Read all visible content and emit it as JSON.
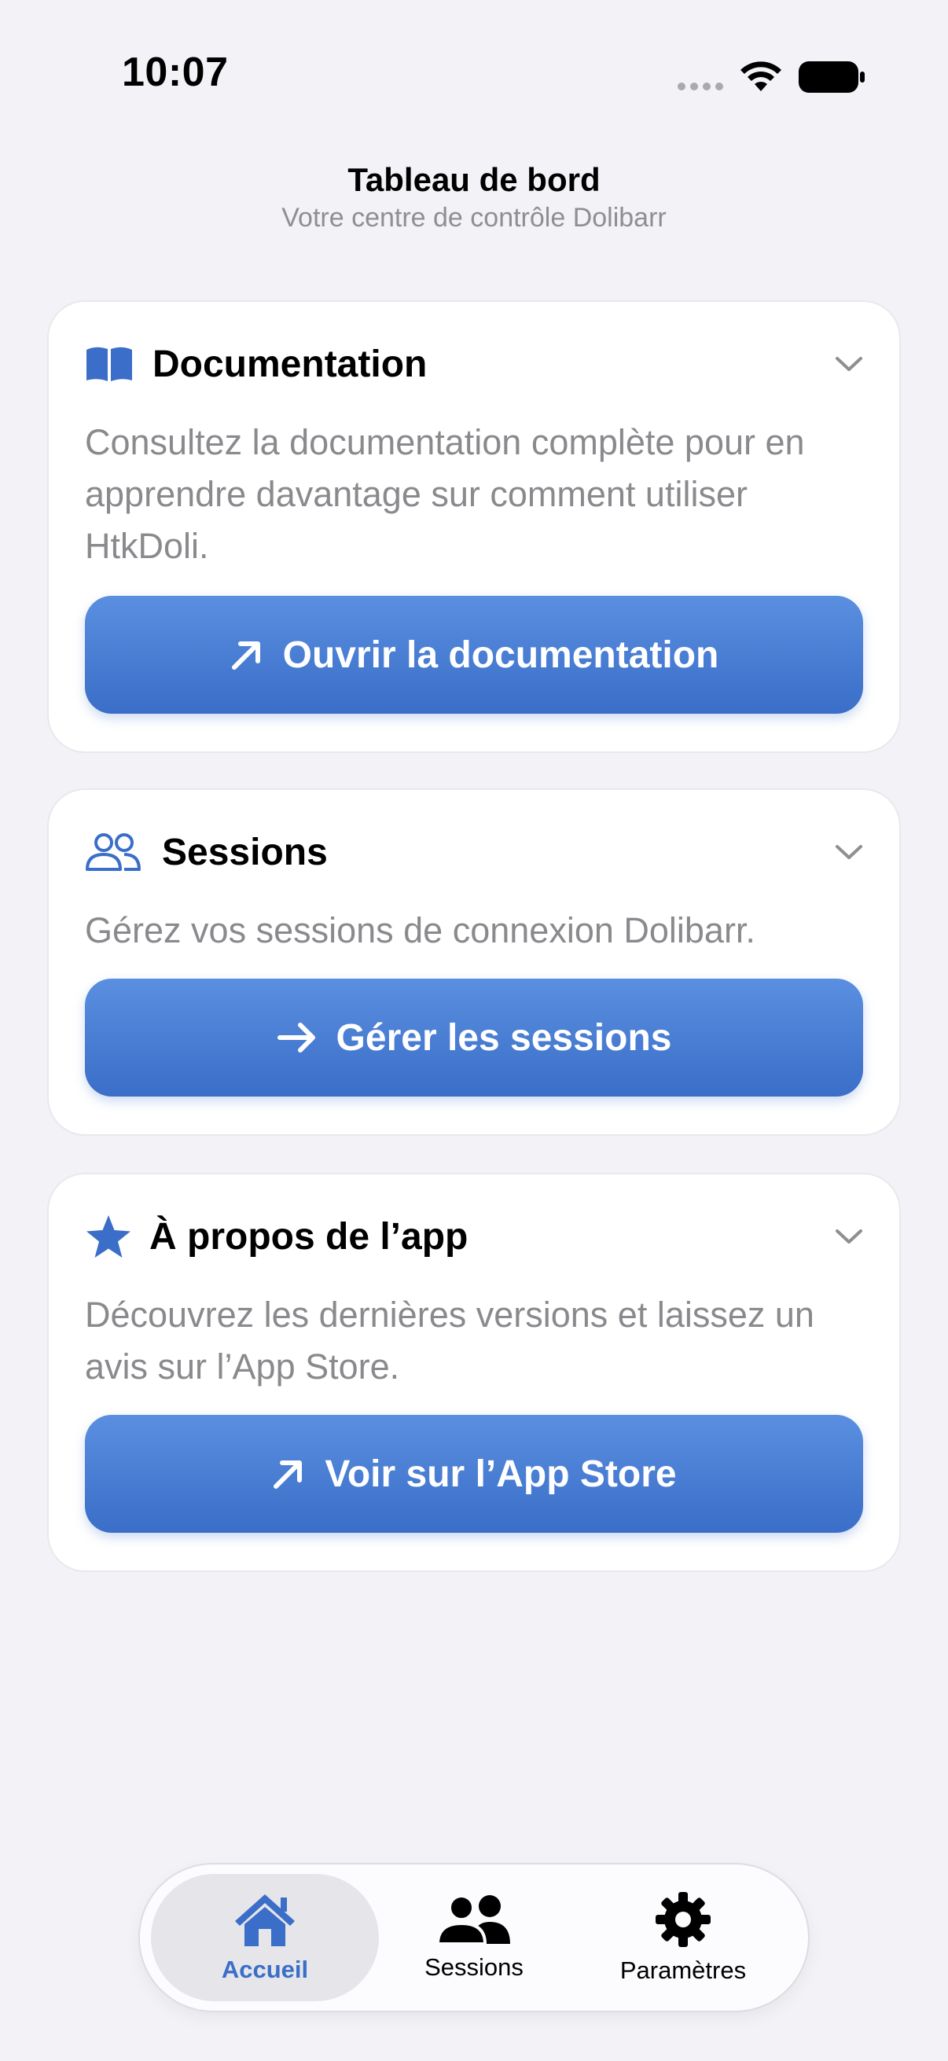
{
  "status_bar": {
    "time": "10:07"
  },
  "header": {
    "title": "Tableau de bord",
    "subtitle": "Votre centre de contrôle Dolibarr"
  },
  "cards": [
    {
      "icon": "book-icon",
      "title": "Documentation",
      "description": "Consultez la documentation complète pour en apprendre davantage sur comment utiliser HtkDoli.",
      "button_icon": "arrow-up-right-icon",
      "button_label": "Ouvrir la documentation"
    },
    {
      "icon": "people-icon",
      "title": "Sessions",
      "description": "Gérez vos sessions de connexion Dolibarr.",
      "button_icon": "arrow-right-icon",
      "button_label": "Gérer les sessions"
    },
    {
      "icon": "star-icon",
      "title": "À propos de l’app",
      "description": "Découvrez les dernières versions et laissez un avis sur l’App Store.",
      "button_icon": "arrow-up-right-icon",
      "button_label": "Voir sur l’App Store"
    }
  ],
  "tabbar": {
    "items": [
      {
        "label": "Accueil",
        "icon": "house-icon",
        "active": true
      },
      {
        "label": "Sessions",
        "icon": "people-fill-icon",
        "active": false
      },
      {
        "label": "Paramètres",
        "icon": "gear-icon",
        "active": false
      }
    ]
  },
  "colors": {
    "accent": "#3a6ec8",
    "background": "#f2f2f7",
    "secondary_text": "#8a8a8e"
  }
}
